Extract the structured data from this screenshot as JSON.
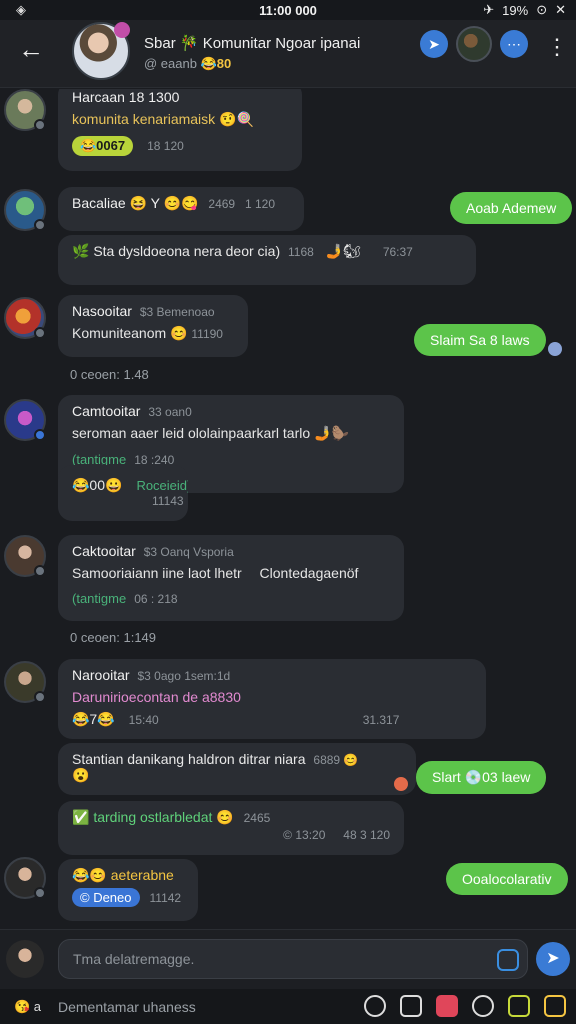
{
  "status": {
    "time": "11:00 000",
    "battery": "19%"
  },
  "header": {
    "title": "Sbar 🎋 Komunitar Ngoar ipanai",
    "subtitle_prefix": "@ eaanb",
    "subtitle_emoji": "😂80"
  },
  "messages": [
    {
      "name": "Harcaan 18 1300",
      "text": "komunita kenariamaisk 🤨🍭",
      "pill": "😂0067",
      "meta": "18 120"
    },
    {
      "name": "Bacaliae 😆 Y 😊😋",
      "meta_top": "2469",
      "meta_mid": "1 120",
      "text": "🌿 Sta dysldoeona nera deor cia)",
      "meta2": "1168",
      "emoji": "🤳🐿",
      "time": "76:37"
    },
    {
      "name": "Nasooitar",
      "meta_head": "$3 Bemenoao",
      "text": "Komuniteanom 😊",
      "meta": "11190"
    },
    {
      "sys": "0 ceoen: 1.48"
    },
    {
      "name": "Camtooitar",
      "meta_head": "33 oan0",
      "text": "seroman aaer leid ololainpaarkarl tarlo 🤳🦫",
      "tag": "(tantigme",
      "tag_meta": "18 :240"
    },
    {
      "reactions": "😂00😀",
      "tag": "Roceieid)",
      "meta": "11143"
    },
    {
      "name": "Caktooitar",
      "meta_head": "$3 Oanq Vsporia",
      "text": "Samooriaiann iine laot lhetr",
      "text_right": "Clontedagaenöf",
      "tag": "(tantigme",
      "tag_meta": "06 : 218"
    },
    {
      "sys": "0 ceoen: 1:149"
    },
    {
      "name": "Narooitar",
      "meta_head": "$3 0ago 1sem:1d",
      "text": "Darunirioecontan de a8830",
      "reactions": "😂7😂",
      "meta": "15:40",
      "time": "31.317"
    },
    {
      "text": "Stantian danikang haldron ditrar niara",
      "meta": "6889 😊",
      "emoji": "😮"
    },
    {
      "text": "✅ tarding ostlarbledat 😊",
      "meta_top": "2465",
      "meta": "© 13:20",
      "time": "48 3 120"
    },
    {
      "name": "😂😊 aeterabne",
      "pill": "© Deneo",
      "meta": "11142"
    }
  ],
  "outgoing": [
    {
      "text": "Aoab Ademew"
    },
    {
      "text": "Slaim Sa 8 laws"
    },
    {
      "text": "Slart 💿03 laew"
    },
    {
      "text": "Ooalocolarativ"
    }
  ],
  "input": {
    "placeholder": "Tma delatremagge."
  },
  "bottom": {
    "left": "😘 a",
    "hint": "Dementamar uhaness"
  }
}
